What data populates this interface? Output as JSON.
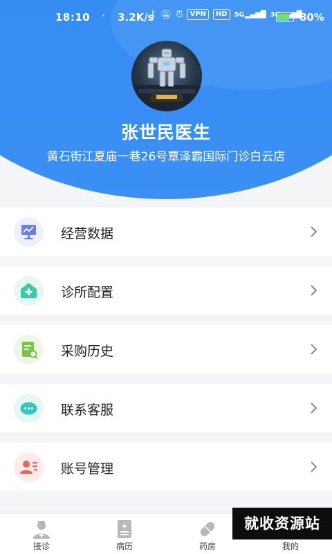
{
  "status_bar": {
    "time": "18:10",
    "dot": "·",
    "network_speed": "3.2K/s",
    "vpn": "VPN",
    "hd": "HD",
    "sig1": "5G",
    "sig2": "3G",
    "battery": "80%",
    "battery_level": 0.8,
    "battery_color": "#6ee07a"
  },
  "profile": {
    "name": "张世民医生",
    "clinic": "黄石街江夏庙一巷26号覃泽霸国际门诊白云店"
  },
  "menu": [
    {
      "label": "经营数据",
      "icon": "chart-monitor-icon",
      "color": "#6b7ff0",
      "bg": "#eef0fd"
    },
    {
      "label": "诊所配置",
      "icon": "clinic-home-icon",
      "color": "#3cc7a7",
      "bg": "#e7f8f3"
    },
    {
      "label": "采购历史",
      "icon": "order-search-icon",
      "color": "#7cc24b",
      "bg": "#eef7e6"
    },
    {
      "label": "联系客服",
      "icon": "chat-bubble-icon",
      "color": "#39c7b5",
      "bg": "#e6f8f5"
    },
    {
      "label": "账号管理",
      "icon": "account-card-icon",
      "color": "#f0645a",
      "bg": "#fdeceb"
    }
  ],
  "tabbar": [
    {
      "label": "接诊",
      "icon": "doctor-icon"
    },
    {
      "label": "病历",
      "icon": "medical-record-icon"
    },
    {
      "label": "药房",
      "icon": "pill-icon"
    },
    {
      "label": "我的",
      "icon": "profile-icon"
    }
  ],
  "watermark": "就收资源站"
}
